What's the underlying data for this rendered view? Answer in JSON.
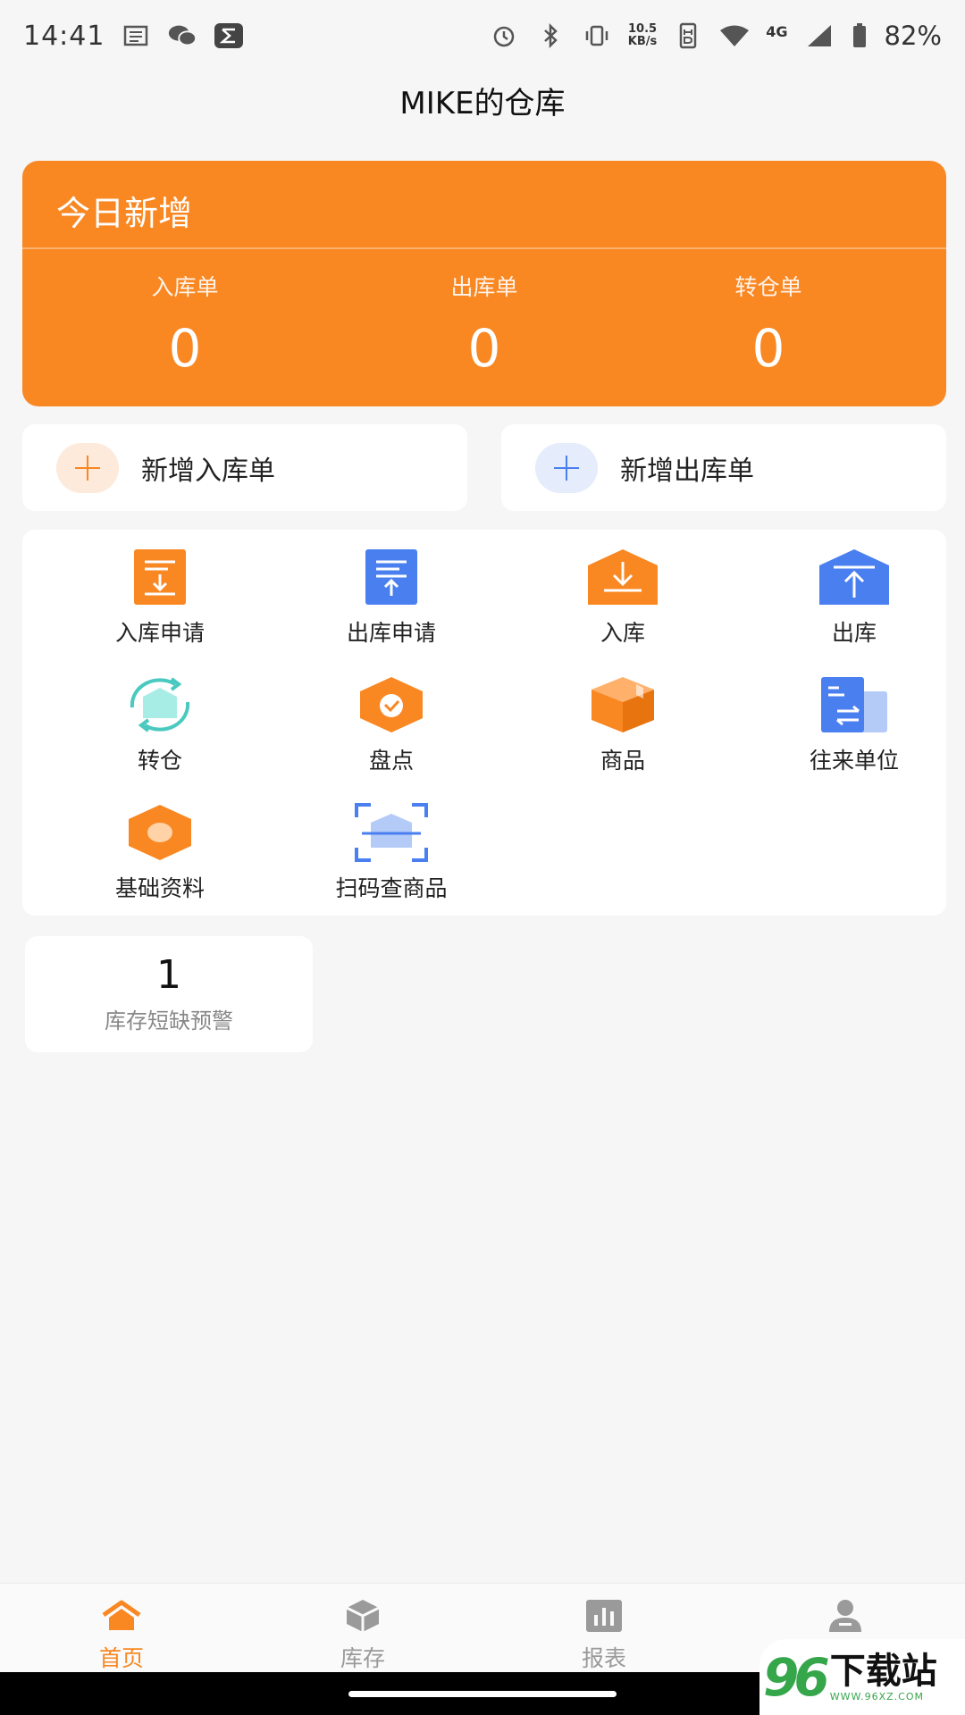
{
  "status_bar": {
    "time": "14:41",
    "net_speed": "10.5",
    "net_unit": "KB/s",
    "net_type": "4G",
    "battery": "82%",
    "icons": [
      "news-icon",
      "wechat-icon",
      "sigma-app-icon",
      "alarm-icon",
      "bluetooth-icon",
      "vibrate-icon",
      "hd-icon",
      "wifi-icon",
      "signal-icon",
      "battery-icon"
    ]
  },
  "header": {
    "title": "MIKE的仓库"
  },
  "today": {
    "title": "今日新增",
    "stats": [
      {
        "label": "入库单",
        "value": "0"
      },
      {
        "label": "出库单",
        "value": "0"
      },
      {
        "label": "转仓单",
        "value": "0"
      }
    ]
  },
  "quick_actions": [
    {
      "label": "新增入库单",
      "icon": "plus-icon",
      "color": "#f98722"
    },
    {
      "label": "新增出库单",
      "icon": "plus-icon",
      "color": "#4a7ff0"
    }
  ],
  "grid": [
    {
      "label": "入库申请",
      "icon": "inbound-request-icon"
    },
    {
      "label": "出库申请",
      "icon": "outbound-request-icon"
    },
    {
      "label": "入库",
      "icon": "inbound-icon"
    },
    {
      "label": "出库",
      "icon": "outbound-icon"
    },
    {
      "label": "转仓",
      "icon": "transfer-icon"
    },
    {
      "label": "盘点",
      "icon": "stocktake-icon"
    },
    {
      "label": "商品",
      "icon": "product-box-icon"
    },
    {
      "label": "往来单位",
      "icon": "partner-icon"
    },
    {
      "label": "基础资料",
      "icon": "basic-data-icon"
    },
    {
      "label": "扫码查商品",
      "icon": "scan-icon"
    }
  ],
  "warning": {
    "value": "1",
    "label": "库存短缺预警"
  },
  "tabs": [
    {
      "label": "首页",
      "icon": "home-icon",
      "active": true
    },
    {
      "label": "库存",
      "icon": "inventory-icon",
      "active": false
    },
    {
      "label": "报表",
      "icon": "report-icon",
      "active": false
    },
    {
      "label": "",
      "icon": "profile-icon",
      "active": false
    }
  ],
  "watermark": {
    "number": "96",
    "text": "下载站",
    "url": "WWW.96XZ.COM"
  },
  "colors": {
    "accent": "#f98722",
    "blue": "#4a7ff0",
    "teal": "#49c9bf",
    "background": "#f6f6f6"
  }
}
